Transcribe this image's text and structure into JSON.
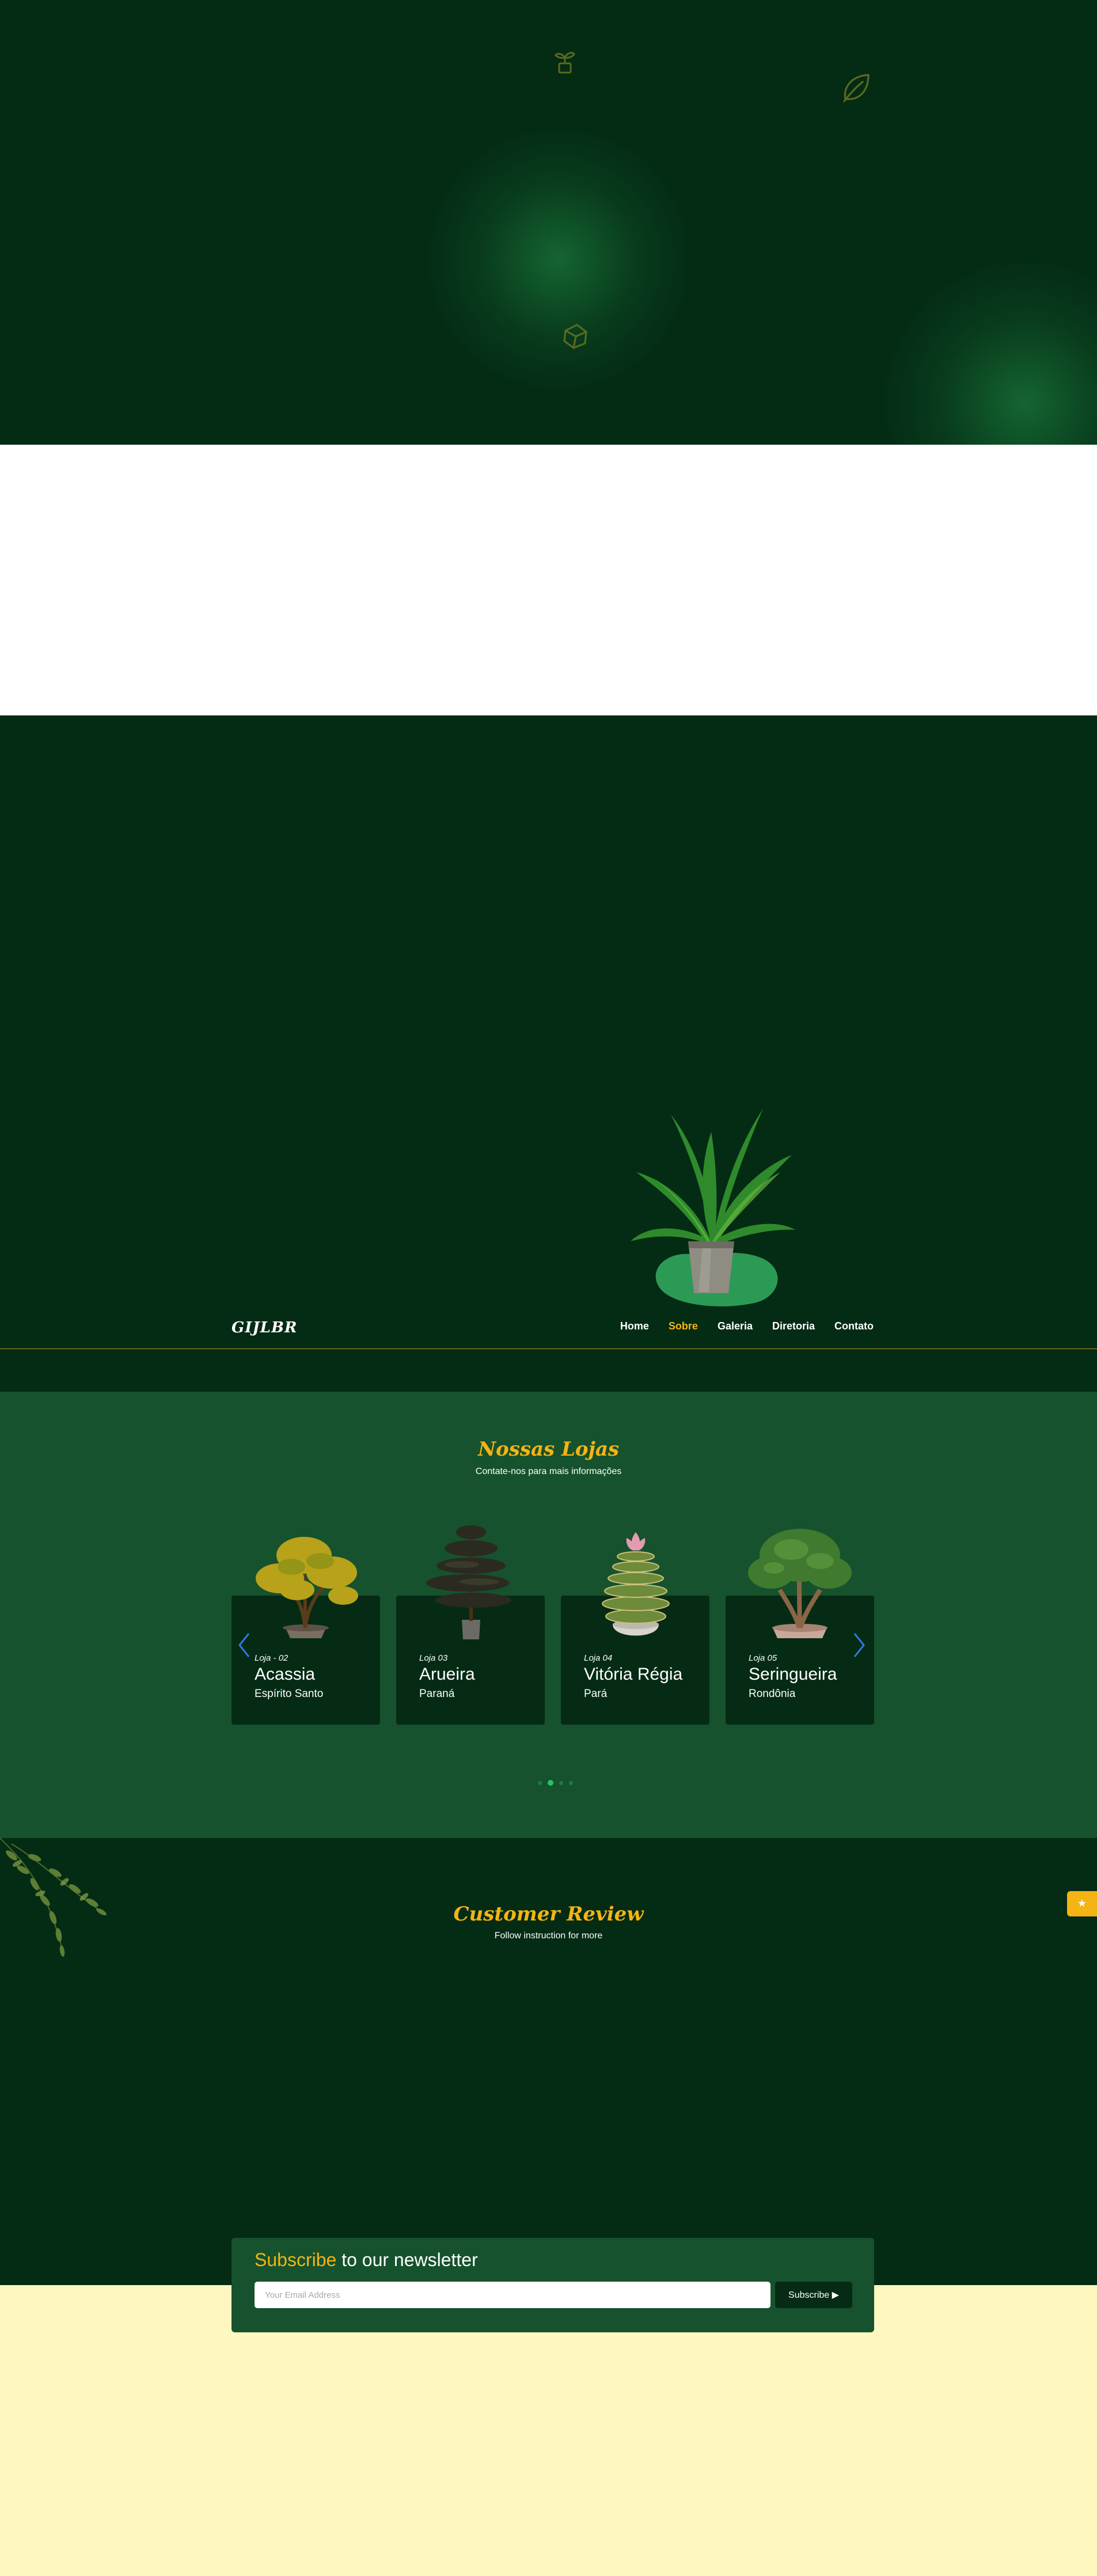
{
  "brand": {
    "logo": "GIJLBR"
  },
  "nav": {
    "items": [
      {
        "label": "Home",
        "active": false
      },
      {
        "label": "Sobre",
        "active": true
      },
      {
        "label": "Galeria",
        "active": false
      },
      {
        "label": "Diretoria",
        "active": false
      },
      {
        "label": "Contato",
        "active": false
      }
    ]
  },
  "hero": {
    "decorative_icons": [
      "sprout-icon",
      "leaf-icon",
      "seed-icon"
    ],
    "image": "potted-plant-icon"
  },
  "stores": {
    "title": "Nossas Lojas",
    "subtitle": "Contate-nos para mais informações",
    "cards": [
      {
        "kicker": "Loja - 02",
        "name": "Acassia",
        "state": "Espírito Santo",
        "image": "yellow-bonsai-icon"
      },
      {
        "kicker": "Loja 03",
        "name": "Arueira",
        "state": "Paraná",
        "image": "pine-bonsai-icon"
      },
      {
        "kicker": "Loja 04",
        "name": "Vitória Régia",
        "state": "Pará",
        "image": "water-lily-plant-icon"
      },
      {
        "kicker": "Loja 05",
        "name": "Seringueira",
        "state": "Rondônia",
        "image": "green-bonsai-icon"
      }
    ],
    "carousel": {
      "pages": 4,
      "active_index": 1
    }
  },
  "review": {
    "title": "Customer Review",
    "subtitle": "Follow instruction for more",
    "float_button_icon": "star-icon"
  },
  "newsletter": {
    "title_accent": "Subscribe",
    "title_rest": " to our newsletter",
    "input_placeholder": "Your Email Address",
    "button_label": "Subscribe ▶"
  },
  "colors": {
    "dark_green": "#042b14",
    "mid_green": "#16522d",
    "accent_yellow": "#f4b414",
    "footer_cream": "#fff7c0"
  }
}
